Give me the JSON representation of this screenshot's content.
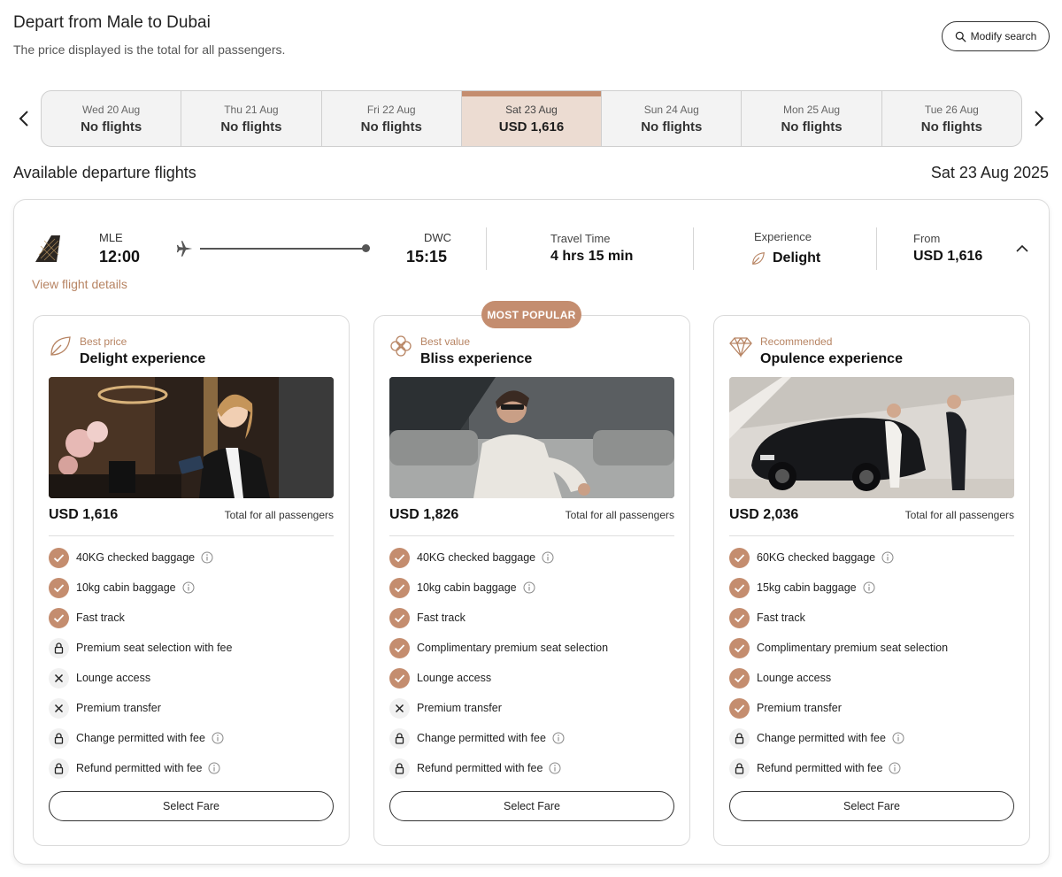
{
  "header": {
    "title": "Depart from Male to Dubai",
    "subtitle": "The price displayed is the total for all passengers.",
    "modify_label": "Modify search"
  },
  "dates": [
    {
      "date": "Wed 20 Aug",
      "price": "No flights",
      "selected": false
    },
    {
      "date": "Thu 21 Aug",
      "price": "No flights",
      "selected": false
    },
    {
      "date": "Fri 22 Aug",
      "price": "No flights",
      "selected": false
    },
    {
      "date": "Sat 23 Aug",
      "price": "USD 1,616",
      "selected": true
    },
    {
      "date": "Sun 24 Aug",
      "price": "No flights",
      "selected": false
    },
    {
      "date": "Mon 25 Aug",
      "price": "No flights",
      "selected": false
    },
    {
      "date": "Tue 26 Aug",
      "price": "No flights",
      "selected": false
    }
  ],
  "results": {
    "title": "Available departure flights",
    "date": "Sat 23 Aug 2025"
  },
  "flight": {
    "origin_code": "MLE",
    "depart_time": "12:00",
    "dest_code": "DWC",
    "arrive_time": "15:15",
    "travel_label": "Travel Time",
    "travel_time": "4 hrs 15 min",
    "experience_label": "Experience",
    "experience": "Delight",
    "from_label": "From",
    "from_price": "USD 1,616",
    "details_link": "View flight details"
  },
  "popular_badge": "MOST POPULAR",
  "fares": [
    {
      "tag": "Best price",
      "name": "Delight experience",
      "icon": "leaf-icon",
      "price": "USD 1,616",
      "total_label": "Total for all passengers",
      "select_label": "Select Fare",
      "features": [
        {
          "label": "40KG checked baggage",
          "status": "check",
          "info": true
        },
        {
          "label": "10kg cabin baggage",
          "status": "check",
          "info": true
        },
        {
          "label": "Fast track",
          "status": "check",
          "info": false
        },
        {
          "label": "Premium seat selection with fee",
          "status": "lock",
          "info": false
        },
        {
          "label": "Lounge access",
          "status": "cross",
          "info": false
        },
        {
          "label": "Premium transfer",
          "status": "cross",
          "info": false
        },
        {
          "label": "Change permitted with fee",
          "status": "lock",
          "info": true
        },
        {
          "label": "Refund permitted with fee",
          "status": "lock",
          "info": true
        }
      ]
    },
    {
      "tag": "Best value",
      "name": "Bliss experience",
      "icon": "flower-icon",
      "price": "USD 1,826",
      "total_label": "Total for all passengers",
      "select_label": "Select Fare",
      "features": [
        {
          "label": "40KG checked baggage",
          "status": "check",
          "info": true
        },
        {
          "label": "10kg cabin baggage",
          "status": "check",
          "info": true
        },
        {
          "label": "Fast track",
          "status": "check",
          "info": false
        },
        {
          "label": "Complimentary premium seat selection",
          "status": "check",
          "info": false
        },
        {
          "label": "Lounge access",
          "status": "check",
          "info": false
        },
        {
          "label": "Premium transfer",
          "status": "cross",
          "info": false
        },
        {
          "label": "Change permitted with fee",
          "status": "lock",
          "info": true
        },
        {
          "label": "Refund permitted with fee",
          "status": "lock",
          "info": true
        }
      ]
    },
    {
      "tag": "Recommended",
      "name": "Opulence experience",
      "icon": "diamond-icon",
      "price": "USD 2,036",
      "total_label": "Total for all passengers",
      "select_label": "Select Fare",
      "features": [
        {
          "label": "60KG checked baggage",
          "status": "check",
          "info": true
        },
        {
          "label": "15kg cabin baggage",
          "status": "check",
          "info": true
        },
        {
          "label": "Fast track",
          "status": "check",
          "info": false
        },
        {
          "label": "Complimentary premium seat selection",
          "status": "check",
          "info": false
        },
        {
          "label": "Lounge access",
          "status": "check",
          "info": false
        },
        {
          "label": "Premium transfer",
          "status": "check",
          "info": false
        },
        {
          "label": "Change permitted with fee",
          "status": "lock",
          "info": true
        },
        {
          "label": "Refund permitted with fee",
          "status": "lock",
          "info": true
        }
      ]
    }
  ],
  "colors": {
    "accent": "#c48d6f",
    "accent_text": "#b78463",
    "selected_date_bg": "#ecdcd2"
  }
}
